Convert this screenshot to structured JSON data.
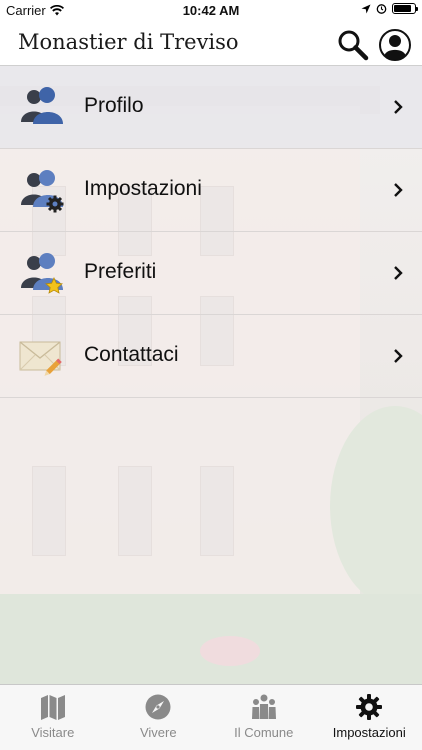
{
  "status_bar": {
    "carrier": "Carrier",
    "time": "10:42 AM",
    "icons": [
      "wifi-icon",
      "location-arrow-icon",
      "alarm-icon",
      "battery-icon"
    ],
    "battery_level": 0.85
  },
  "header": {
    "title": "Monastier di Treviso",
    "search_icon": "search-icon",
    "profile_icon": "user-profile-icon"
  },
  "menu": {
    "items": [
      {
        "label": "Profilo",
        "icon": "users-icon",
        "selected": true
      },
      {
        "label": "Impostazioni",
        "icon": "users-gear-icon",
        "selected": false
      },
      {
        "label": "Preferiti",
        "icon": "users-star-icon",
        "selected": false
      },
      {
        "label": "Contattaci",
        "icon": "envelope-pencil-icon",
        "selected": false
      }
    ]
  },
  "tab_bar": {
    "tabs": [
      {
        "label": "Visitare",
        "icon": "map-icon",
        "active": false
      },
      {
        "label": "Vivere",
        "icon": "compass-icon",
        "active": false
      },
      {
        "label": "Il Comune",
        "icon": "people-group-icon",
        "active": false
      },
      {
        "label": "Impostazioni",
        "icon": "gear-icon",
        "active": true
      }
    ]
  },
  "colors": {
    "icon_blue": "#3f64a8",
    "icon_dark": "#3a3f4a",
    "tab_inactive": "#8a8a8a",
    "tab_active": "#111111"
  }
}
